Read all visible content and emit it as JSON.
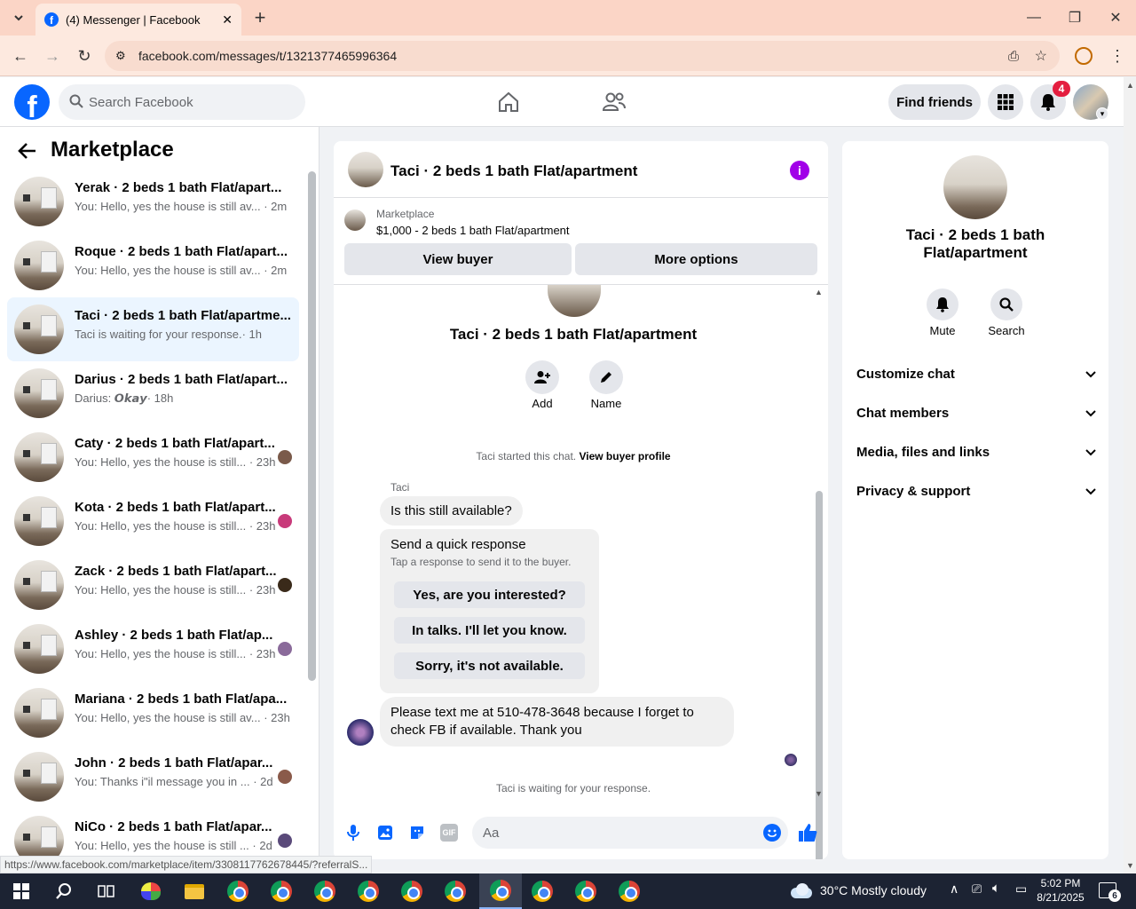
{
  "browser": {
    "tab_title": "(4) Messenger | Facebook",
    "url": "facebook.com/messages/t/1321377465996364",
    "status_url": "https://www.facebook.com/marketplace/item/3308117762678445/?referralS..."
  },
  "header": {
    "search_placeholder": "Search Facebook",
    "find_friends": "Find friends",
    "notification_count": "4"
  },
  "left": {
    "title": "Marketplace",
    "conversations": [
      {
        "title": "Yerak · 2 beds 1 bath Flat/apart...",
        "snippet": "You: Hello, yes the house is still av...",
        "time": "· 2m"
      },
      {
        "title": "Roque · 2 beds 1 bath Flat/apart...",
        "snippet": "You: Hello, yes the house is still av...",
        "time": "· 2m"
      },
      {
        "title": "Taci · 2 beds 1 bath Flat/apartme...",
        "snippet": "Taci is waiting for your response.",
        "time": "· 1h"
      },
      {
        "title": "Darius · 2 beds 1 bath Flat/apart...",
        "snippet": "Darius: 𝙊𝙠𝙖𝙮",
        "time": "· 18h"
      },
      {
        "title": "Caty · 2 beds 1 bath Flat/apart...",
        "snippet": "You: Hello, yes the house is still...",
        "time": "· 23h"
      },
      {
        "title": "Kota · 2 beds 1 bath Flat/apart...",
        "snippet": "You: Hello, yes the house is still...",
        "time": "· 23h"
      },
      {
        "title": "Zack · 2 beds 1 bath Flat/apart...",
        "snippet": "You: Hello, yes the house is still...",
        "time": "· 23h"
      },
      {
        "title": "Ashley · 2 beds 1 bath Flat/ap...",
        "snippet": "You: Hello, yes the house is still...",
        "time": "· 23h"
      },
      {
        "title": "Mariana · 2 beds 1 bath Flat/apa...",
        "snippet": "You: Hello, yes the house is still av...",
        "time": "· 23h"
      },
      {
        "title": "John · 2 beds 1 bath Flat/apar...",
        "snippet": "You: Thanks i\"il message you in ...",
        "time": "· 2d"
      },
      {
        "title": "NiCo · 2 beds 1 bath Flat/apar...",
        "snippet": "You: Hello, yes the house is still ...",
        "time": "· 2d"
      }
    ]
  },
  "chat": {
    "header_title": "Taci · 2 beds 1 bath Flat/apartment",
    "listing_source": "Marketplace",
    "listing_price_title": "$1,000 - 2 beds 1 bath Flat/apartment",
    "view_buyer": "View buyer",
    "more_options": "More options",
    "profile_name": "Taci · 2 beds 1 bath Flat/apartment",
    "add_label": "Add",
    "name_label": "Name",
    "started_text": "Taci started this chat.",
    "view_profile": "View buyer profile",
    "sender_name": "Taci",
    "msg1": "Is this still available?",
    "quick_title": "Send a quick response",
    "quick_sub": "Tap a response to send it to the buyer.",
    "quick_responses": [
      "Yes, are you interested?",
      "In talks. I'll let you know.",
      "Sorry, it's not available."
    ],
    "msg2": "Please text me at 510-478-3648 because I forget to check FB if available.  Thank you",
    "waiting": "Taci is waiting for your response.",
    "composer_placeholder": "Aa"
  },
  "info": {
    "title": "Taci · 2 beds 1 bath Flat/apartment",
    "mute": "Mute",
    "search": "Search",
    "sections": [
      "Customize chat",
      "Chat members",
      "Media, files and links",
      "Privacy & support"
    ]
  },
  "taskbar": {
    "weather": "30°C  Mostly cloudy",
    "time": "5:02 PM",
    "date": "8/21/2025",
    "notif_count": "6"
  }
}
